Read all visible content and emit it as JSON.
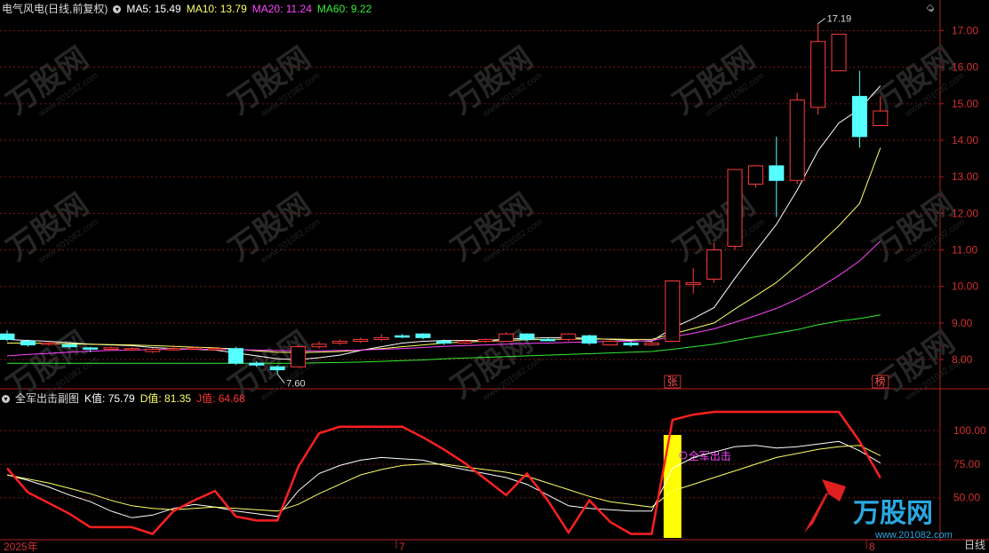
{
  "header": {
    "stock_title": "电气风电(日线,前复权)",
    "ma5": "MA5: 15.49",
    "ma10": "MA10: 13.79",
    "ma20": "MA20: 11.24",
    "ma60": "MA60: 9.22",
    "ma_colors": {
      "ma5": "#ffffff",
      "ma10": "#ffff66",
      "ma20": "#ff44ff",
      "ma60": "#33ee33"
    }
  },
  "subchart": {
    "title": "全军出击副图",
    "k": "K值: 75.79",
    "d": "D值: 81.35",
    "j": "J值: 64.68",
    "signal_label": "全军出击"
  },
  "x_axis": {
    "start_label": "2025年",
    "month_7": "7",
    "month_8": "8",
    "period": "日线"
  },
  "watermark": {
    "brand": "万股网",
    "site": "www.201082.com"
  },
  "chart_data": [
    {
      "type": "candlestick",
      "y_ticks": [
        8.0,
        9.0,
        10.0,
        11.0,
        12.0,
        13.0,
        14.0,
        15.0,
        16.0,
        17.0
      ],
      "ylim": [
        7.2,
        17.4
      ],
      "annotations": [
        {
          "index": 13,
          "text": "7.60"
        },
        {
          "index": 39,
          "text": "17.19"
        }
      ],
      "markers": [
        {
          "index": 32,
          "text": "张"
        },
        {
          "index": 42,
          "text": "榜"
        }
      ],
      "candles": [
        [
          8.7,
          8.55,
          8.8,
          8.5
        ],
        [
          8.5,
          8.4,
          8.55,
          8.35
        ],
        [
          8.42,
          8.45,
          8.5,
          8.38
        ],
        [
          8.4,
          8.35,
          8.45,
          8.3
        ],
        [
          8.32,
          8.3,
          8.35,
          8.2
        ],
        [
          8.28,
          8.32,
          8.36,
          8.24
        ],
        [
          8.3,
          8.3,
          8.34,
          8.25
        ],
        [
          8.22,
          8.28,
          8.32,
          8.18
        ],
        [
          8.28,
          8.3,
          8.4,
          8.25
        ],
        [
          8.3,
          8.32,
          8.35,
          8.26
        ],
        [
          8.3,
          8.3,
          8.34,
          8.26
        ],
        [
          8.3,
          7.9,
          8.35,
          7.85
        ],
        [
          7.9,
          7.85,
          7.96,
          7.8
        ],
        [
          7.8,
          7.72,
          7.84,
          7.6
        ],
        [
          7.8,
          8.35,
          8.4,
          7.78
        ],
        [
          8.35,
          8.42,
          8.5,
          8.3
        ],
        [
          8.45,
          8.5,
          8.55,
          8.4
        ],
        [
          8.5,
          8.55,
          8.6,
          8.45
        ],
        [
          8.55,
          8.6,
          8.7,
          8.5
        ],
        [
          8.65,
          8.62,
          8.7,
          8.58
        ],
        [
          8.7,
          8.6,
          8.72,
          8.55
        ],
        [
          8.5,
          8.45,
          8.55,
          8.4
        ],
        [
          8.45,
          8.5,
          8.55,
          8.42
        ],
        [
          8.5,
          8.55,
          8.58,
          8.45
        ],
        [
          8.5,
          8.7,
          8.75,
          8.48
        ],
        [
          8.7,
          8.55,
          8.72,
          8.5
        ],
        [
          8.55,
          8.52,
          8.6,
          8.5
        ],
        [
          8.55,
          8.7,
          8.72,
          8.5
        ],
        [
          8.65,
          8.45,
          8.68,
          8.4
        ],
        [
          8.4,
          8.5,
          8.55,
          8.38
        ],
        [
          8.45,
          8.4,
          8.5,
          8.35
        ],
        [
          8.4,
          8.45,
          8.5,
          8.38
        ],
        [
          8.5,
          10.15,
          10.15,
          8.48
        ],
        [
          10.05,
          10.1,
          10.5,
          9.8
        ],
        [
          10.2,
          11.0,
          11.2,
          10.1
        ],
        [
          11.1,
          13.2,
          13.2,
          11.0
        ],
        [
          12.8,
          13.3,
          13.3,
          12.7
        ],
        [
          13.3,
          12.9,
          14.1,
          11.9
        ],
        [
          12.9,
          15.1,
          15.3,
          12.8
        ],
        [
          14.9,
          16.7,
          17.19,
          14.7
        ],
        [
          15.9,
          16.9,
          16.9,
          15.9
        ],
        [
          15.2,
          14.1,
          15.9,
          13.8
        ],
        [
          14.4,
          14.8,
          15.2,
          14.4
        ]
      ],
      "series": [
        {
          "name": "MA5",
          "values": [
            8.55,
            8.52,
            8.5,
            8.46,
            8.42,
            8.4,
            8.38,
            8.33,
            8.3,
            8.28,
            8.26,
            8.18,
            8.1,
            8.02,
            8.0,
            8.05,
            8.12,
            8.25,
            8.35,
            8.45,
            8.5,
            8.52,
            8.52,
            8.52,
            8.56,
            8.58,
            8.6,
            8.6,
            8.58,
            8.55,
            8.52,
            8.5,
            8.86,
            9.12,
            9.42,
            10.22,
            10.97,
            11.7,
            12.64,
            13.71,
            14.47,
            14.85,
            15.49
          ]
        },
        {
          "name": "MA10",
          "values": [
            8.45,
            8.45,
            8.44,
            8.43,
            8.42,
            8.41,
            8.4,
            8.38,
            8.36,
            8.34,
            8.32,
            8.29,
            8.24,
            8.2,
            8.19,
            8.2,
            8.22,
            8.26,
            8.3,
            8.35,
            8.4,
            8.45,
            8.48,
            8.5,
            8.52,
            8.54,
            8.55,
            8.56,
            8.56,
            8.56,
            8.55,
            8.55,
            8.7,
            8.85,
            9.0,
            9.38,
            9.74,
            10.11,
            10.59,
            11.12,
            11.66,
            12.27,
            13.79
          ]
        },
        {
          "name": "MA20",
          "values": [
            8.1,
            8.14,
            8.17,
            8.2,
            8.23,
            8.25,
            8.26,
            8.27,
            8.28,
            8.28,
            8.28,
            8.27,
            8.26,
            8.25,
            8.24,
            8.24,
            8.25,
            8.26,
            8.28,
            8.3,
            8.33,
            8.36,
            8.38,
            8.4,
            8.42,
            8.44,
            8.45,
            8.47,
            8.48,
            8.5,
            8.5,
            8.52,
            8.62,
            8.72,
            8.84,
            9.02,
            9.2,
            9.4,
            9.65,
            9.95,
            10.3,
            10.7,
            11.24
          ]
        },
        {
          "name": "MA60",
          "values": [
            7.9,
            7.9,
            7.9,
            7.9,
            7.9,
            7.9,
            7.9,
            7.9,
            7.9,
            7.9,
            7.9,
            7.9,
            7.9,
            7.9,
            7.9,
            7.91,
            7.92,
            7.93,
            7.95,
            7.97,
            7.99,
            8.02,
            8.04,
            8.06,
            8.08,
            8.1,
            8.12,
            8.14,
            8.16,
            8.18,
            8.2,
            8.22,
            8.28,
            8.35,
            8.42,
            8.52,
            8.62,
            8.72,
            8.82,
            8.95,
            9.05,
            9.12,
            9.22
          ]
        }
      ]
    },
    {
      "type": "line",
      "y_ticks": [
        50.0,
        75.0,
        100.0
      ],
      "ylim": [
        20,
        118
      ],
      "highlight_index": 32,
      "series": [
        {
          "name": "K",
          "values": [
            67,
            63,
            58,
            52,
            47,
            40,
            35,
            37,
            42,
            45,
            43,
            40,
            38,
            36,
            55,
            68,
            74,
            78,
            80,
            79,
            78,
            74,
            71,
            68,
            65,
            60,
            52,
            44,
            42,
            41,
            40,
            40,
            72,
            80,
            84,
            88,
            89,
            87,
            88,
            90,
            92,
            85,
            75.79
          ]
        },
        {
          "name": "D",
          "values": [
            67,
            64,
            61,
            57,
            53,
            48,
            44,
            42,
            41,
            42,
            43,
            42,
            41,
            40,
            45,
            53,
            60,
            67,
            71,
            74,
            75,
            75,
            73,
            71,
            69,
            66,
            61,
            56,
            51,
            47,
            45,
            43,
            55,
            60,
            65,
            70,
            75,
            80,
            83,
            86,
            88,
            89,
            81.35
          ]
        },
        {
          "name": "J",
          "values": [
            72,
            54,
            46,
            38,
            28,
            28,
            28,
            22,
            40,
            48,
            55,
            36,
            33,
            33,
            73,
            98,
            103,
            103,
            103,
            103,
            95,
            86,
            76,
            64,
            52,
            68,
            48,
            24,
            48,
            32,
            14,
            8,
            108,
            112,
            114,
            122,
            125,
            116,
            118,
            115,
            115,
            92,
            64.68
          ]
        }
      ]
    }
  ]
}
